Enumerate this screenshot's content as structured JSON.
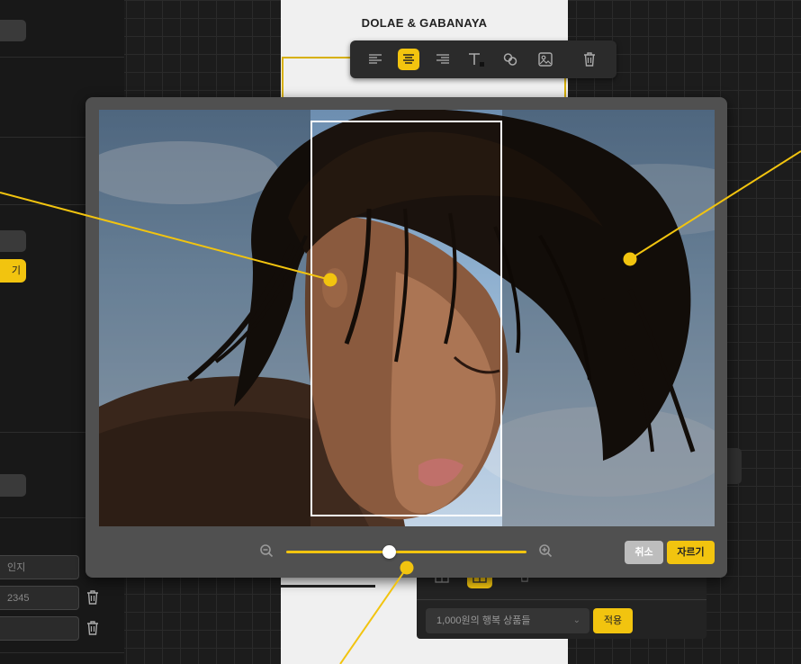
{
  "document": {
    "title": "DOLAE & GABANAYA"
  },
  "toolbar": {
    "buttons": [
      {
        "name": "align-left-icon",
        "active": false
      },
      {
        "name": "align-center-icon",
        "active": true
      },
      {
        "name": "align-right-icon",
        "active": false
      },
      {
        "name": "text-color-icon",
        "active": false
      },
      {
        "name": "link-icon",
        "active": false
      },
      {
        "name": "image-icon",
        "active": false
      },
      {
        "name": "trash-icon",
        "active": false
      }
    ]
  },
  "sidebar": {
    "partial_button_label": "기",
    "inputs": [
      {
        "value": "인지"
      },
      {
        "value": "2345"
      },
      {
        "value": ""
      }
    ]
  },
  "crop_modal": {
    "zoom_level": 0.43,
    "cancel_label": "취소",
    "crop_label": "자르기"
  },
  "product_panel": {
    "select_value": "1,000원의 행복 상품들",
    "apply_label": "적용"
  },
  "colors": {
    "accent": "#f2c40f",
    "modal_bg": "#505050",
    "app_bg": "#1c1c1c"
  }
}
